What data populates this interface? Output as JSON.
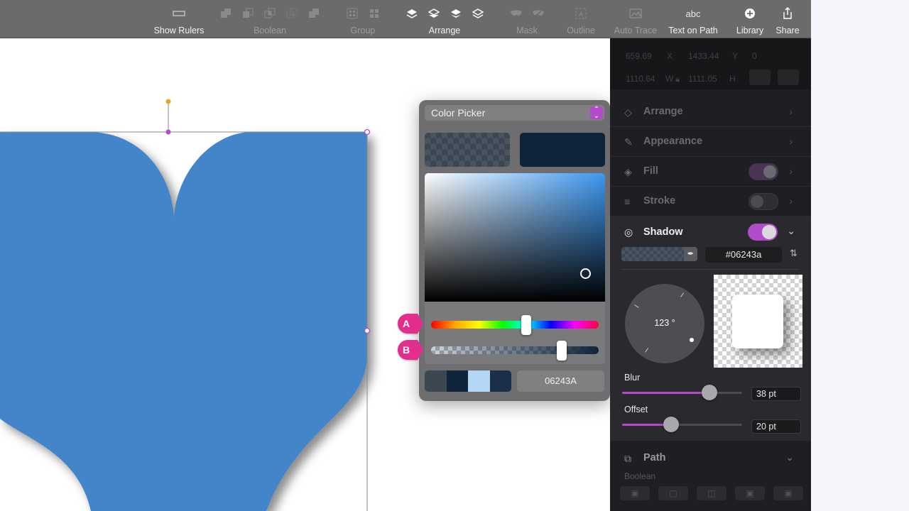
{
  "toolbar": {
    "show_rulers": "Show Rulers",
    "boolean": "Boolean",
    "group": "Group",
    "arrange": "Arrange",
    "mask": "Mask",
    "outline": "Outline",
    "auto_trace": "Auto Trace",
    "text_on_path": "Text on Path",
    "text_on_path_glyph": "abc",
    "library": "Library",
    "share": "Share"
  },
  "color_picker": {
    "mode": "Color Picker",
    "hex": "06243A",
    "hue_slider_label": "A",
    "alpha_slider_label": "B",
    "current_color": "#0f233a",
    "recent_colors": [
      "#3d4752",
      "#0f233a",
      "#b4d6f5",
      "#1b3048"
    ]
  },
  "inspector": {
    "geometry": {
      "x_value": "659.69",
      "x_label": "X",
      "y_value": "1433.44",
      "y_label": "Y",
      "rotation_value": "0",
      "w_value": "1110.64",
      "w_label": "W",
      "h_value": "1111.05",
      "h_label": "H"
    },
    "sections": {
      "arrange": "Arrange",
      "appearance": "Appearance",
      "fill": "Fill",
      "stroke": "Stroke",
      "shadow": "Shadow",
      "path": "Path"
    },
    "shadow": {
      "hex": "#06243a",
      "angle": "123 °",
      "blur_label": "Blur",
      "blur_value": "38 pt",
      "blur_fraction": 0.73,
      "offset_label": "Offset",
      "offset_value": "20 pt",
      "offset_fraction": 0.41
    },
    "path": {
      "boolean_label": "Boolean"
    }
  },
  "colors": {
    "accent": "#b14bc9",
    "shape_fill": "#4285c8",
    "badge": "#e32e8e"
  }
}
